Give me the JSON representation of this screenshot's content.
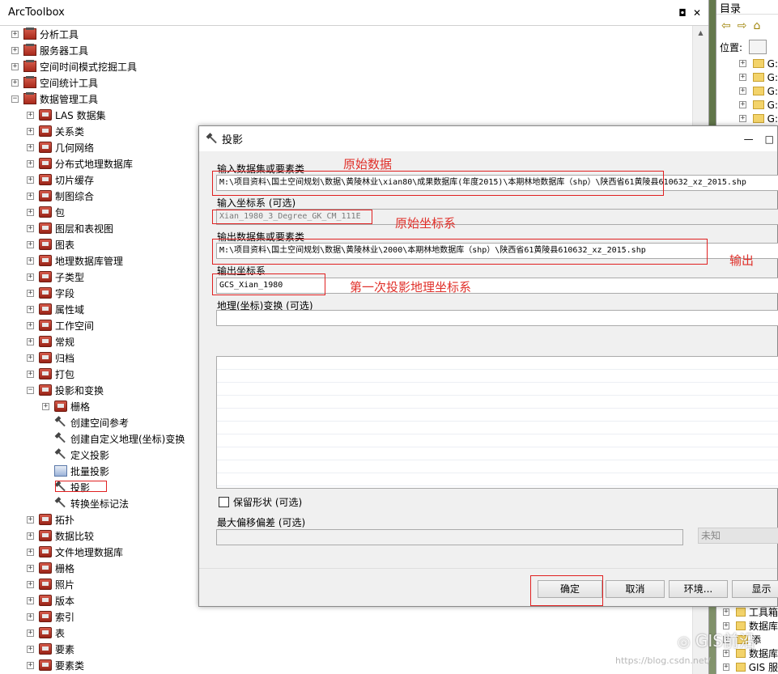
{
  "toolbox": {
    "title": "ArcToolbox",
    "controls": {
      "pin": "◘",
      "close": "✕"
    },
    "items": [
      {
        "label": "分析工具",
        "icon": "toolbox-icon",
        "expander": "+",
        "level": 0
      },
      {
        "label": "服务器工具",
        "icon": "toolbox-icon",
        "expander": "+",
        "level": 0
      },
      {
        "label": "空间时间模式挖掘工具",
        "icon": "toolbox-icon",
        "expander": "+",
        "level": 0
      },
      {
        "label": "空间统计工具",
        "icon": "toolbox-icon",
        "expander": "+",
        "level": 0
      },
      {
        "label": "数据管理工具",
        "icon": "toolbox-icon",
        "expander": "−",
        "level": 0
      },
      {
        "label": "LAS 数据集",
        "icon": "toolset-icon",
        "expander": "+",
        "level": 1
      },
      {
        "label": "关系类",
        "icon": "toolset-icon",
        "expander": "+",
        "level": 1
      },
      {
        "label": "几何网络",
        "icon": "toolset-icon",
        "expander": "+",
        "level": 1
      },
      {
        "label": "分布式地理数据库",
        "icon": "toolset-icon",
        "expander": "+",
        "level": 1
      },
      {
        "label": "切片缓存",
        "icon": "toolset-icon",
        "expander": "+",
        "level": 1
      },
      {
        "label": "制图综合",
        "icon": "toolset-icon",
        "expander": "+",
        "level": 1
      },
      {
        "label": "包",
        "icon": "toolset-icon",
        "expander": "+",
        "level": 1
      },
      {
        "label": "图层和表视图",
        "icon": "toolset-icon",
        "expander": "+",
        "level": 1
      },
      {
        "label": "图表",
        "icon": "toolset-icon",
        "expander": "+",
        "level": 1
      },
      {
        "label": "地理数据库管理",
        "icon": "toolset-icon",
        "expander": "+",
        "level": 1
      },
      {
        "label": "子类型",
        "icon": "toolset-icon",
        "expander": "+",
        "level": 1
      },
      {
        "label": "字段",
        "icon": "toolset-icon",
        "expander": "+",
        "level": 1
      },
      {
        "label": "属性域",
        "icon": "toolset-icon",
        "expander": "+",
        "level": 1
      },
      {
        "label": "工作空间",
        "icon": "toolset-icon",
        "expander": "+",
        "level": 1
      },
      {
        "label": "常规",
        "icon": "toolset-icon",
        "expander": "+",
        "level": 1
      },
      {
        "label": "归档",
        "icon": "toolset-icon",
        "expander": "+",
        "level": 1
      },
      {
        "label": "打包",
        "icon": "toolset-icon",
        "expander": "+",
        "level": 1
      },
      {
        "label": "投影和变换",
        "icon": "toolset-icon",
        "expander": "−",
        "level": 1
      },
      {
        "label": "栅格",
        "icon": "toolset-icon",
        "expander": "+",
        "level": 2
      },
      {
        "label": "创建空间参考",
        "icon": "tool-icon",
        "expander": "",
        "level": 2
      },
      {
        "label": "创建自定义地理(坐标)变换",
        "icon": "tool-icon",
        "expander": "",
        "level": 2
      },
      {
        "label": "定义投影",
        "icon": "tool-icon",
        "expander": "",
        "level": 2
      },
      {
        "label": "批量投影",
        "icon": "script-icon",
        "expander": "",
        "level": 2
      },
      {
        "label": "投影",
        "icon": "tool-icon",
        "expander": "",
        "level": 2
      },
      {
        "label": "转换坐标记法",
        "icon": "tool-icon",
        "expander": "",
        "level": 2
      },
      {
        "label": "拓扑",
        "icon": "toolset-icon",
        "expander": "+",
        "level": 1
      },
      {
        "label": "数据比较",
        "icon": "toolset-icon",
        "expander": "+",
        "level": 1
      },
      {
        "label": "文件地理数据库",
        "icon": "toolset-icon",
        "expander": "+",
        "level": 1
      },
      {
        "label": "栅格",
        "icon": "toolset-icon",
        "expander": "+",
        "level": 1
      },
      {
        "label": "照片",
        "icon": "toolset-icon",
        "expander": "+",
        "level": 1
      },
      {
        "label": "版本",
        "icon": "toolset-icon",
        "expander": "+",
        "level": 1
      },
      {
        "label": "索引",
        "icon": "toolset-icon",
        "expander": "+",
        "level": 1
      },
      {
        "label": "表",
        "icon": "toolset-icon",
        "expander": "+",
        "level": 1
      },
      {
        "label": "要素",
        "icon": "toolset-icon",
        "expander": "+",
        "level": 1
      },
      {
        "label": "要素类",
        "icon": "toolset-icon",
        "expander": "+",
        "level": 1
      }
    ]
  },
  "catalog": {
    "title": "目录",
    "location_label": "位置:",
    "folders": [
      "G:",
      "G:",
      "G:",
      "G:",
      "G:"
    ],
    "bottom_items": [
      "工具箱",
      "数据库",
      "添",
      "数据库",
      "GIS 服"
    ]
  },
  "dialog": {
    "title": "投影",
    "controls": {
      "minimize": "—",
      "maximize": "□"
    },
    "input_dataset_label": "输入数据集或要素类",
    "input_dataset_value": "M:\\项目资料\\国土空间规划\\数据\\黄陵林业\\xian80\\成果数据库(年度2015)\\本期林地数据库（shp）\\陕西省61黄陵县610632_xz_2015.shp",
    "input_cs_label": "输入坐标系 (可选)",
    "input_cs_value": "Xian_1980_3_Degree_GK_CM_111E",
    "output_dataset_label": "输出数据集或要素类",
    "output_dataset_value": "M:\\项目资料\\国土空间规划\\数据\\黄陵林业\\2000\\本期林地数据库（shp）\\陕西省61黄陵县610632_xz_2015.shp",
    "output_cs_label": "输出坐标系",
    "output_cs_value": "GCS_Xian_1980",
    "geo_transform_label": "地理(坐标)变换 (可选)",
    "preserve_shape_label": "保留形状 (可选)",
    "max_offset_label": "最大偏移偏差 (可选)",
    "unknown_label": "未知",
    "buttons": {
      "ok": "确定",
      "cancel": "取消",
      "env": "环境...",
      "show": "显示"
    }
  },
  "annotations": {
    "input_data": "原始数据",
    "input_cs": "原始坐标系",
    "output": "输出",
    "output_cs": "第一次投影地理坐标系"
  },
  "watermark": {
    "text": "GIS前沿",
    "url": "https://blog.csdn.net/"
  },
  "colors": {
    "annotation_red": "#e02020"
  }
}
